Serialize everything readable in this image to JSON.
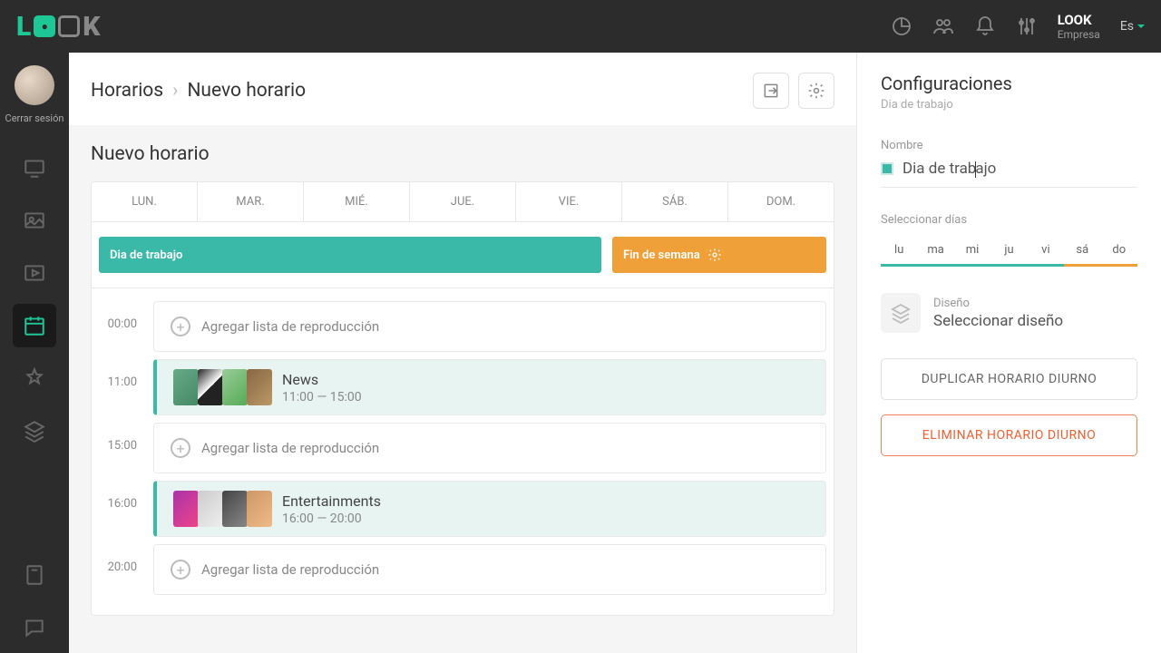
{
  "header": {
    "user_name": "LOOK",
    "user_role": "Empresa",
    "lang": "Es"
  },
  "sidebar": {
    "logout": "Cerrar sesión"
  },
  "breadcrumb": {
    "root": "Horarios",
    "current": "Nuevo horario"
  },
  "page": {
    "title": "Nuevo horario"
  },
  "week": [
    "LUN.",
    "MAR.",
    "MIÉ.",
    "JUE.",
    "VIE.",
    "SÁB.",
    "DOM."
  ],
  "blocks": {
    "work": "Dia de trabajo",
    "weekend": "Fin de semana"
  },
  "timeline": {
    "add_label": "Agregar lista de reproducción",
    "rows": [
      {
        "time": "00:00",
        "type": "empty"
      },
      {
        "time": "11:00",
        "type": "filled",
        "title": "News",
        "range": "11:00 — 15:00"
      },
      {
        "time": "15:00",
        "type": "empty"
      },
      {
        "time": "16:00",
        "type": "filled",
        "title": "Entertainments",
        "range": "16:00 — 20:00"
      },
      {
        "time": "20:00",
        "type": "empty"
      }
    ]
  },
  "panel": {
    "title": "Configuraciones",
    "subtitle": "Dia de trabajo",
    "name_label": "Nombre",
    "name_value_a": "Dia de trab",
    "name_value_b": "ajo",
    "days_label": "Seleccionar días",
    "days": [
      "lu",
      "ma",
      "mi",
      "ju",
      "vi",
      "sá",
      "do"
    ],
    "design_label": "Diseño",
    "design_value": "Seleccionar diseño",
    "duplicate": "DUPLICAR HORARIO DIURNO",
    "delete": "ELIMINAR HORARIO DIURNO"
  }
}
